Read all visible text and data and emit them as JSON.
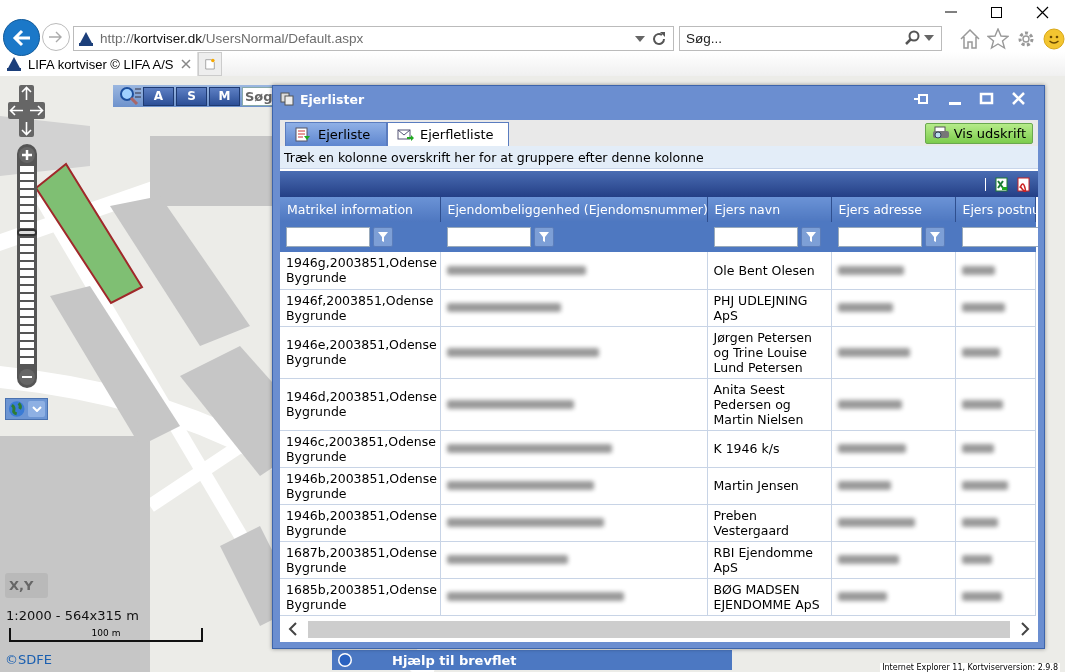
{
  "browser": {
    "address": {
      "prefix": "http://",
      "domain": "kortviser.dk",
      "path": "/UsersNormal/Default.aspx"
    },
    "search": {
      "placeholder": "Søg..."
    },
    "tabs": [
      {
        "title": "LIFA kortviser © LIFA A/S",
        "selected": true
      }
    ]
  },
  "map": {
    "kind": "picture",
    "toolbar": {
      "buttons": [
        "A",
        "S",
        "M"
      ],
      "search_value": "Søg"
    },
    "zoom": {
      "level": 0.67
    },
    "coordinate_button": "X,Y",
    "scale_text": "1:2000 - 564x315 m",
    "scale_bar": "100 m",
    "copyright": "©SDFE",
    "help_bar": "Hjælp til brevflet",
    "status": "Internet Explorer 11, Kortviserversion: 2.9.8"
  },
  "dialog": {
    "title": "Ejerlister",
    "tabs": [
      {
        "label": "Ejerliste",
        "selected": false
      },
      {
        "label": "Ejerfletliste",
        "selected": true
      }
    ],
    "print_button": "Vis udskrift",
    "group_hint": "Træk en kolonne overskrift her for at gruppere efter denne kolonne",
    "table": {
      "columns": [
        "Matrikel information",
        "Ejendombeliggenhed (Ejendomsnummer)",
        "Ejers navn",
        "Ejers adresse",
        "Ejers postnu"
      ],
      "rows": [
        {
          "cells": [
            {
              "kind": "text",
              "text": "1946g,2003851,Odense Bygrunde"
            },
            {
              "kind": "blurred"
            },
            {
              "kind": "text",
              "text": "Ole Bent Olesen"
            },
            {
              "kind": "blurred"
            },
            {
              "kind": "blurred"
            }
          ]
        },
        {
          "cells": [
            {
              "kind": "text",
              "text": "1946f,2003851,Odense Bygrunde"
            },
            {
              "kind": "blurred"
            },
            {
              "kind": "text",
              "text": "PHJ UDLEJNING ApS"
            },
            {
              "kind": "blurred"
            },
            {
              "kind": "blurred"
            }
          ]
        },
        {
          "cells": [
            {
              "kind": "text",
              "text": "1946e,2003851,Odense Bygrunde"
            },
            {
              "kind": "blurred"
            },
            {
              "kind": "text",
              "text": "Jørgen Petersen og Trine Louise Lund Petersen"
            },
            {
              "kind": "blurred"
            },
            {
              "kind": "blurred"
            }
          ]
        },
        {
          "cells": [
            {
              "kind": "text",
              "text": "1946d,2003851,Odense Bygrunde"
            },
            {
              "kind": "blurred"
            },
            {
              "kind": "text",
              "text": "Anita Seest Pedersen og Martin Nielsen"
            },
            {
              "kind": "blurred"
            },
            {
              "kind": "blurred"
            }
          ]
        },
        {
          "cells": [
            {
              "kind": "text",
              "text": "1946c,2003851,Odense Bygrunde"
            },
            {
              "kind": "blurred"
            },
            {
              "kind": "text",
              "text": "K 1946 k/s"
            },
            {
              "kind": "blurred"
            },
            {
              "kind": "blurred"
            }
          ]
        },
        {
          "cells": [
            {
              "kind": "text",
              "text": "1946b,2003851,Odense Bygrunde"
            },
            {
              "kind": "blurred"
            },
            {
              "kind": "text",
              "text": "Martin Jensen"
            },
            {
              "kind": "blurred"
            },
            {
              "kind": "blurred"
            }
          ]
        },
        {
          "cells": [
            {
              "kind": "text",
              "text": "1946b,2003851,Odense Bygrunde"
            },
            {
              "kind": "blurred"
            },
            {
              "kind": "text",
              "text": "Preben Vestergaard"
            },
            {
              "kind": "blurred"
            },
            {
              "kind": "blurred"
            }
          ]
        },
        {
          "cells": [
            {
              "kind": "text",
              "text": "1687b,2003851,Odense Bygrunde"
            },
            {
              "kind": "blurred"
            },
            {
              "kind": "text",
              "text": "RBI Ejendomme ApS"
            },
            {
              "kind": "blurred"
            },
            {
              "kind": "blurred"
            }
          ]
        },
        {
          "cells": [
            {
              "kind": "text",
              "text": "1685b,2003851,Odense Bygrunde"
            },
            {
              "kind": "blurred"
            },
            {
              "kind": "text",
              "text": "BØG MADSEN EJENDOMME ApS"
            },
            {
              "kind": "blurred"
            },
            {
              "kind": "blurred"
            }
          ]
        }
      ]
    }
  }
}
